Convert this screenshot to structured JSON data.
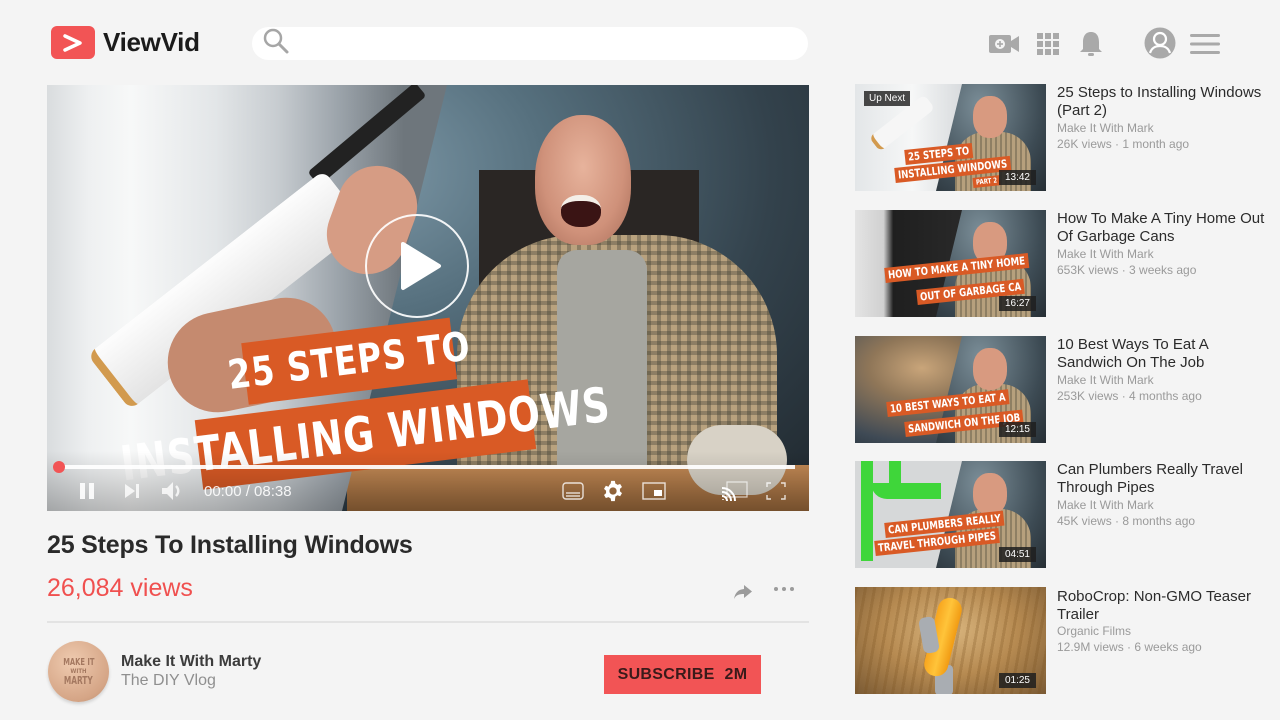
{
  "app": {
    "name": "ViewVid",
    "brand_color": "#f25455"
  },
  "header": {
    "search": {
      "placeholder": "",
      "value": "",
      "icon": "search-icon"
    },
    "icons": [
      "create-video-icon",
      "apps-grid-icon",
      "notifications-bell-icon",
      "account-avatar-icon",
      "menu-icon"
    ]
  },
  "player": {
    "overlay_line1": "25 STEPS TO",
    "overlay_line2": "INSTALLING WINDOWS",
    "current_time": "00:00",
    "duration": "08:38",
    "time_display": "00:00 / 08:38",
    "progress_fraction": 0.0,
    "state": "paused",
    "controls": [
      "pause",
      "next",
      "volume",
      "captions",
      "settings",
      "miniplayer",
      "cast",
      "fullscreen"
    ]
  },
  "video": {
    "title": "25 Steps To Installing Windows",
    "views": "26,084 views",
    "accent_color": "#f0504f"
  },
  "channel": {
    "avatar_text": [
      "MAKE IT",
      "WITH",
      "MARTY"
    ],
    "name": "Make It With Marty",
    "subtitle": "The DIY Vlog",
    "subscribe_label": "SUBSCRIBE",
    "subscriber_count": "2M"
  },
  "sidebar": {
    "up_next_label": "Up Next",
    "items": [
      {
        "title": "25 Steps to Installing Windows (Part 2)",
        "channel": "Make It With Mark",
        "meta": "26K views · 1 month ago",
        "duration": "13:42",
        "thumb_text": [
          "25 STEPS TO",
          "INSTALLING WINDOWS",
          "PART 2"
        ]
      },
      {
        "title": "How To Make A Tiny Home Out Of Garbage Cans",
        "channel": "Make It With Mark",
        "meta": "653K views · 3 weeks ago",
        "duration": "16:27",
        "thumb_text": [
          "HOW TO MAKE A TINY HOME",
          "OUT OF GARBAGE CA"
        ]
      },
      {
        "title": "10 Best Ways To Eat A Sandwich On The Job",
        "channel": "Make It With Mark",
        "meta": "253K views · 4 months ago",
        "duration": "12:15",
        "thumb_text": [
          "10 BEST WAYS TO EAT A",
          "SANDWICH ON THE JOB"
        ]
      },
      {
        "title": "Can Plumbers Really Travel Through Pipes",
        "channel": "Make It With Mark",
        "meta": "45K views · 8 months ago",
        "duration": "04:51",
        "thumb_text": [
          "CAN PLUMBERS REALLY",
          "TRAVEL THROUGH PIPES"
        ]
      },
      {
        "title": "RoboCrop: Non-GMO Teaser Trailer",
        "channel": "Organic Films",
        "meta": "12.9M views · 6 weeks ago",
        "duration": "01:25",
        "thumb_text": []
      }
    ]
  }
}
